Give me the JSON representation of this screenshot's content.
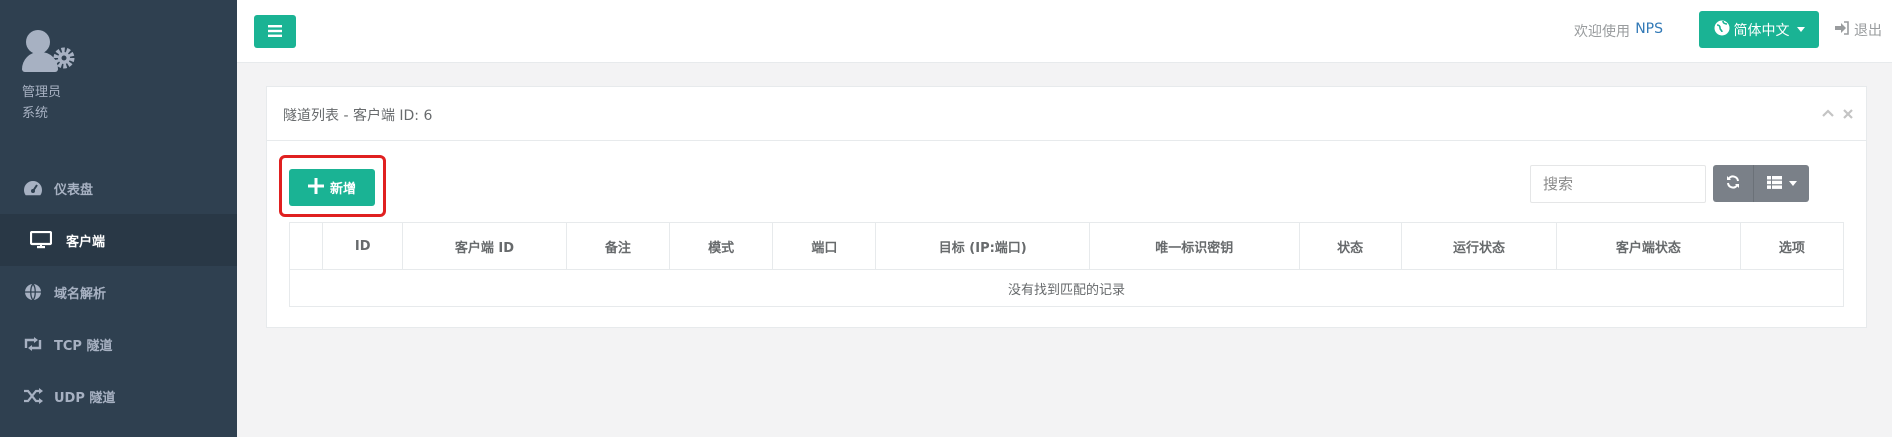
{
  "sidebar": {
    "profile": {
      "name": "管理员",
      "role": "系统"
    },
    "items": [
      {
        "label": "仪表盘",
        "icon": "dashboard-icon"
      },
      {
        "label": "客户端",
        "icon": "desktop-icon",
        "active": true
      },
      {
        "label": "域名解析",
        "icon": "globe-icon"
      },
      {
        "label": "TCP 隧道",
        "icon": "retweet-icon"
      },
      {
        "label": "UDP 隧道",
        "icon": "shuffle-icon"
      }
    ]
  },
  "topbar": {
    "welcome": "欢迎使用",
    "brand_link": "NPS",
    "language": "简体中文",
    "logout": "退出"
  },
  "panel": {
    "title": "隧道列表 - 客户端 ID: 6",
    "add_button": "新增",
    "search_placeholder": "搜索",
    "columns": [
      "ID",
      "客户端 ID",
      "备注",
      "模式",
      "端口",
      "目标 (IP:端口)",
      "唯一标识密钥",
      "状态",
      "运行状态",
      "客户端状态",
      "选项"
    ],
    "empty_message": "没有找到匹配的记录"
  },
  "colors": {
    "accent": "#1ab394",
    "sidebar_bg": "#2f4050",
    "highlight": "#e02020"
  }
}
